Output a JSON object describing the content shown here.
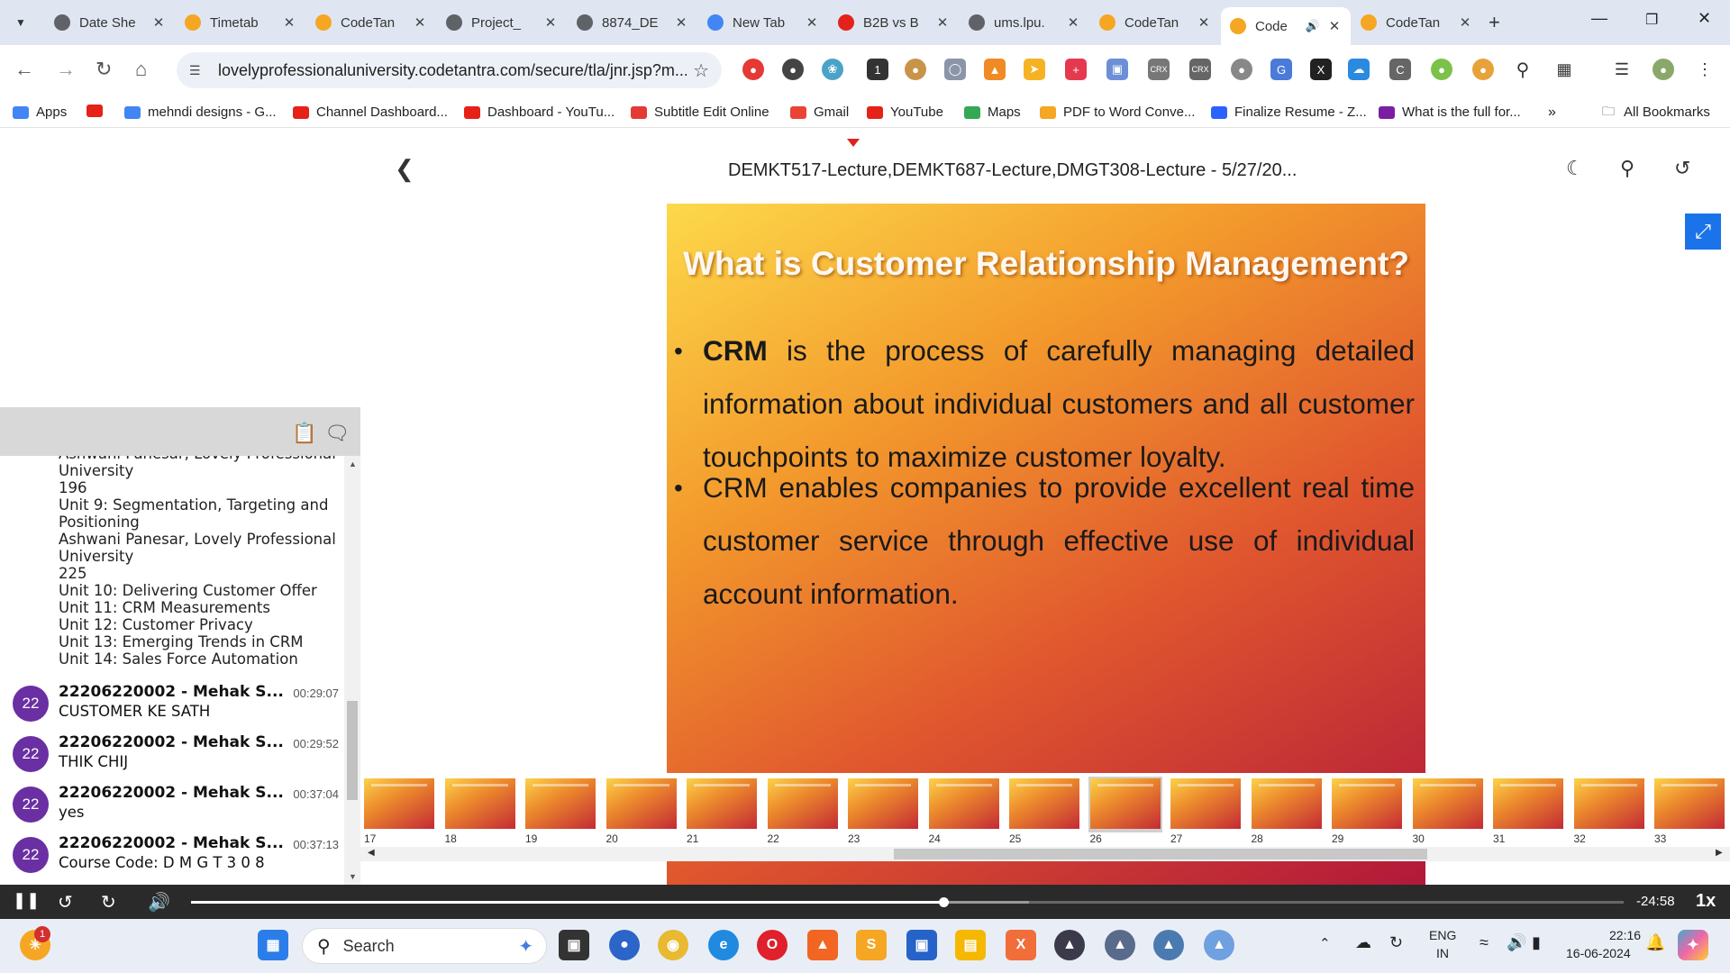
{
  "tabs": [
    {
      "label": "Date She",
      "fav": "globe"
    },
    {
      "label": "Timetab",
      "fav": "codetantra"
    },
    {
      "label": "CodeTan",
      "fav": "codetantra"
    },
    {
      "label": "Project_",
      "fav": "globe"
    },
    {
      "label": "8874_DE",
      "fav": "globe"
    },
    {
      "label": "New Tab",
      "fav": "chrome"
    },
    {
      "label": "B2B vs B",
      "fav": "adobe"
    },
    {
      "label": "ums.lpu.",
      "fav": "globe"
    },
    {
      "label": "CodeTan",
      "fav": "codetantra"
    },
    {
      "label": "Code",
      "fav": "codetantra",
      "active": true
    },
    {
      "label": "CodeTan",
      "fav": "codetantra"
    }
  ],
  "omnibox": {
    "url": "lovelyprofessionaluniversity.codetantra.com/secure/tla/jnr.jsp?m..."
  },
  "bookmarks": [
    {
      "label": "Apps",
      "icon": "apps-grid"
    },
    {
      "label": "",
      "icon": "youtube"
    },
    {
      "label": "mehndi designs - G...",
      "icon": "google"
    },
    {
      "label": "Channel Dashboard...",
      "icon": "youtube"
    },
    {
      "label": "Dashboard - YouTu...",
      "icon": "youtube"
    },
    {
      "label": "Subtitle Edit Online",
      "icon": "subtitle-edit"
    },
    {
      "label": "Gmail",
      "icon": "gmail"
    },
    {
      "label": "YouTube",
      "icon": "youtube"
    },
    {
      "label": "Maps",
      "icon": "maps"
    },
    {
      "label": "PDF to Word Conve...",
      "icon": "pdf"
    },
    {
      "label": "Finalize Resume - Z...",
      "icon": "zety"
    },
    {
      "label": "What is the full for...",
      "icon": "book"
    }
  ],
  "all_bookmarks_label": "All Bookmarks",
  "chat": {
    "context_lines": [
      "Ashwani Panesar, Lovely Professional",
      "University",
      "196",
      "Unit 9: Segmentation, Targeting and",
      "Positioning",
      "Ashwani Panesar, Lovely Professional",
      "University",
      "225",
      "Unit 10: Delivering Customer Offer",
      "Unit 11: CRM Measurements",
      "Unit 12: Customer Privacy",
      "Unit 13: Emerging Trends in CRM",
      "Unit 14: Sales Force Automation"
    ],
    "messages": [
      {
        "avatar": "22",
        "sender": "22206220002 - Mehak S...",
        "time": "00:29:07",
        "text": "CUSTOMER KE SATH"
      },
      {
        "avatar": "22",
        "sender": "22206220002 - Mehak S...",
        "time": "00:29:52",
        "text": "THIK CHIJ"
      },
      {
        "avatar": "22",
        "sender": "22206220002 - Mehak S...",
        "time": "00:37:04",
        "text": "yes"
      },
      {
        "avatar": "22",
        "sender": "22206220002 - Mehak S...",
        "time": "00:37:13",
        "text": "Course Code: D M G T 3 0 8"
      }
    ]
  },
  "lecture": {
    "title": "DEMKT517-Lecture,DEMKT687-Lecture,DMGT308-Lecture - 5/27/20..."
  },
  "slide": {
    "title": "What is Customer Relationship Management?",
    "bullet1_bold": "CRM",
    "bullet1_rest": " is the process of carefully managing detailed information about individual customers and all customer touchpoints to maximize  customer loyalty.",
    "bullet2": "CRM enables companies to provide excellent real time customer service through effective use of individual account information."
  },
  "thumbnails": [
    "17",
    "18",
    "19",
    "20",
    "21",
    "22",
    "23",
    "24",
    "25",
    "26",
    "27",
    "28",
    "29",
    "30",
    "31",
    "32",
    "33"
  ],
  "current_thumbnail": "26",
  "player": {
    "remaining": "-24:58",
    "speed": "1x",
    "progress": 0.525,
    "buffered": 0.585
  },
  "taskbar": {
    "search_label": "Search",
    "lang_line1": "ENG",
    "lang_line2": "IN",
    "time": "22:16",
    "date": "16-06-2024",
    "notification_count": "1"
  }
}
